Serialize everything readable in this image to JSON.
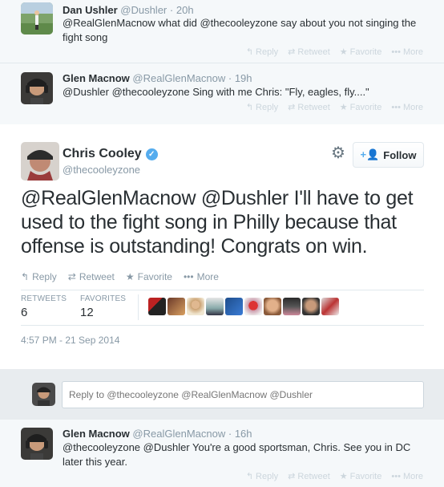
{
  "conversation_before": [
    {
      "name": "Dan Ushler",
      "handle": "@Dushler",
      "time": "20h",
      "text": "@RealGlenMacnow what did @thecooleyzone say about you not singing the fight song"
    },
    {
      "name": "Glen Macnow",
      "handle": "@RealGlenMacnow",
      "time": "19h",
      "text": "@Dushler @thecooleyzone Sing with me Chris: \"Fly, eagles, fly....\""
    }
  ],
  "faded_actions": {
    "reply": "Reply",
    "retweet": "Retweet",
    "favorite": "Favorite",
    "more": "More"
  },
  "main_tweet": {
    "name": "Chris Cooley",
    "handle": "@thecooleyzone",
    "follow_label": "Follow",
    "text": "@RealGlenMacnow @Dushler  I'll have to get used to the fight song in Philly because that offense is outstanding!  Congrats on win.",
    "actions": {
      "reply": "Reply",
      "retweet": "Retweet",
      "favorite": "Favorite",
      "more": "More"
    },
    "stats": {
      "retweets_label": "RETWEETS",
      "retweets": "6",
      "favorites_label": "FAVORITES",
      "favorites": "12"
    },
    "timestamp": "4:57 PM - 21 Sep 2014"
  },
  "reply_box": {
    "placeholder": "Reply to @thecooleyzone @RealGlenMacnow @Dushler"
  },
  "conversation_after": [
    {
      "name": "Glen Macnow",
      "handle": "@RealGlenMacnow",
      "time": "16h",
      "text": "@thecooleyzone @Dushler You're a good sportsman, Chris. See you in DC later this year."
    }
  ],
  "colors": {
    "accent": "#55acee",
    "muted": "#8899a6",
    "text": "#292f33",
    "faded_bg": "#f5f8fa",
    "reply_area_bg": "#e8ecef"
  },
  "icons": [
    "reply-icon",
    "retweet-icon",
    "favorite-star-icon",
    "more-dots-icon",
    "gear-icon",
    "follow-person-icon",
    "verified-badge-icon"
  ]
}
